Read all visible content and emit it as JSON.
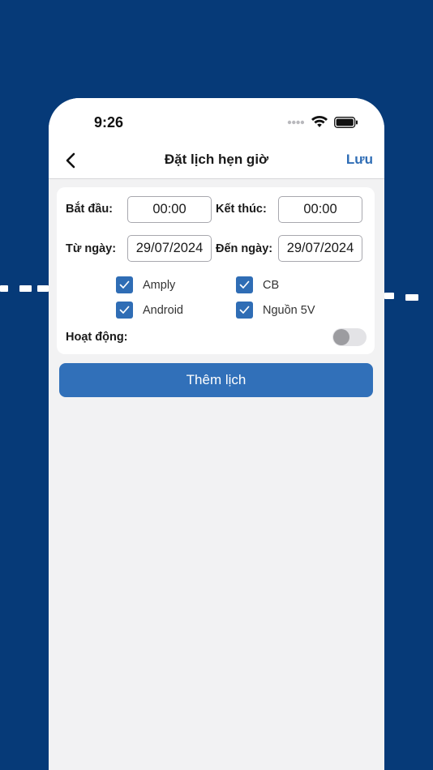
{
  "status_bar": {
    "time": "9:26"
  },
  "nav": {
    "title": "Đặt lịch hẹn giờ",
    "save_label": "Lưu"
  },
  "form": {
    "start_label": "Bắt đầu:",
    "start_value": "00:00",
    "end_label": "Kết thúc:",
    "end_value": "00:00",
    "from_date_label": "Từ ngày:",
    "from_date_value": "29/07/2024",
    "to_date_label": "Đến ngày:",
    "to_date_value": "29/07/2024",
    "checkboxes": [
      {
        "label": "Amply",
        "checked": true
      },
      {
        "label": "CB",
        "checked": true
      },
      {
        "label": "Android",
        "checked": true
      },
      {
        "label": "Nguồn 5V",
        "checked": true
      }
    ],
    "active_label": "Hoạt động:",
    "active_on": false
  },
  "add_button_label": "Thêm lịch",
  "colors": {
    "background": "#063a78",
    "accent": "#2f6db5",
    "surface": "#f2f2f3"
  }
}
